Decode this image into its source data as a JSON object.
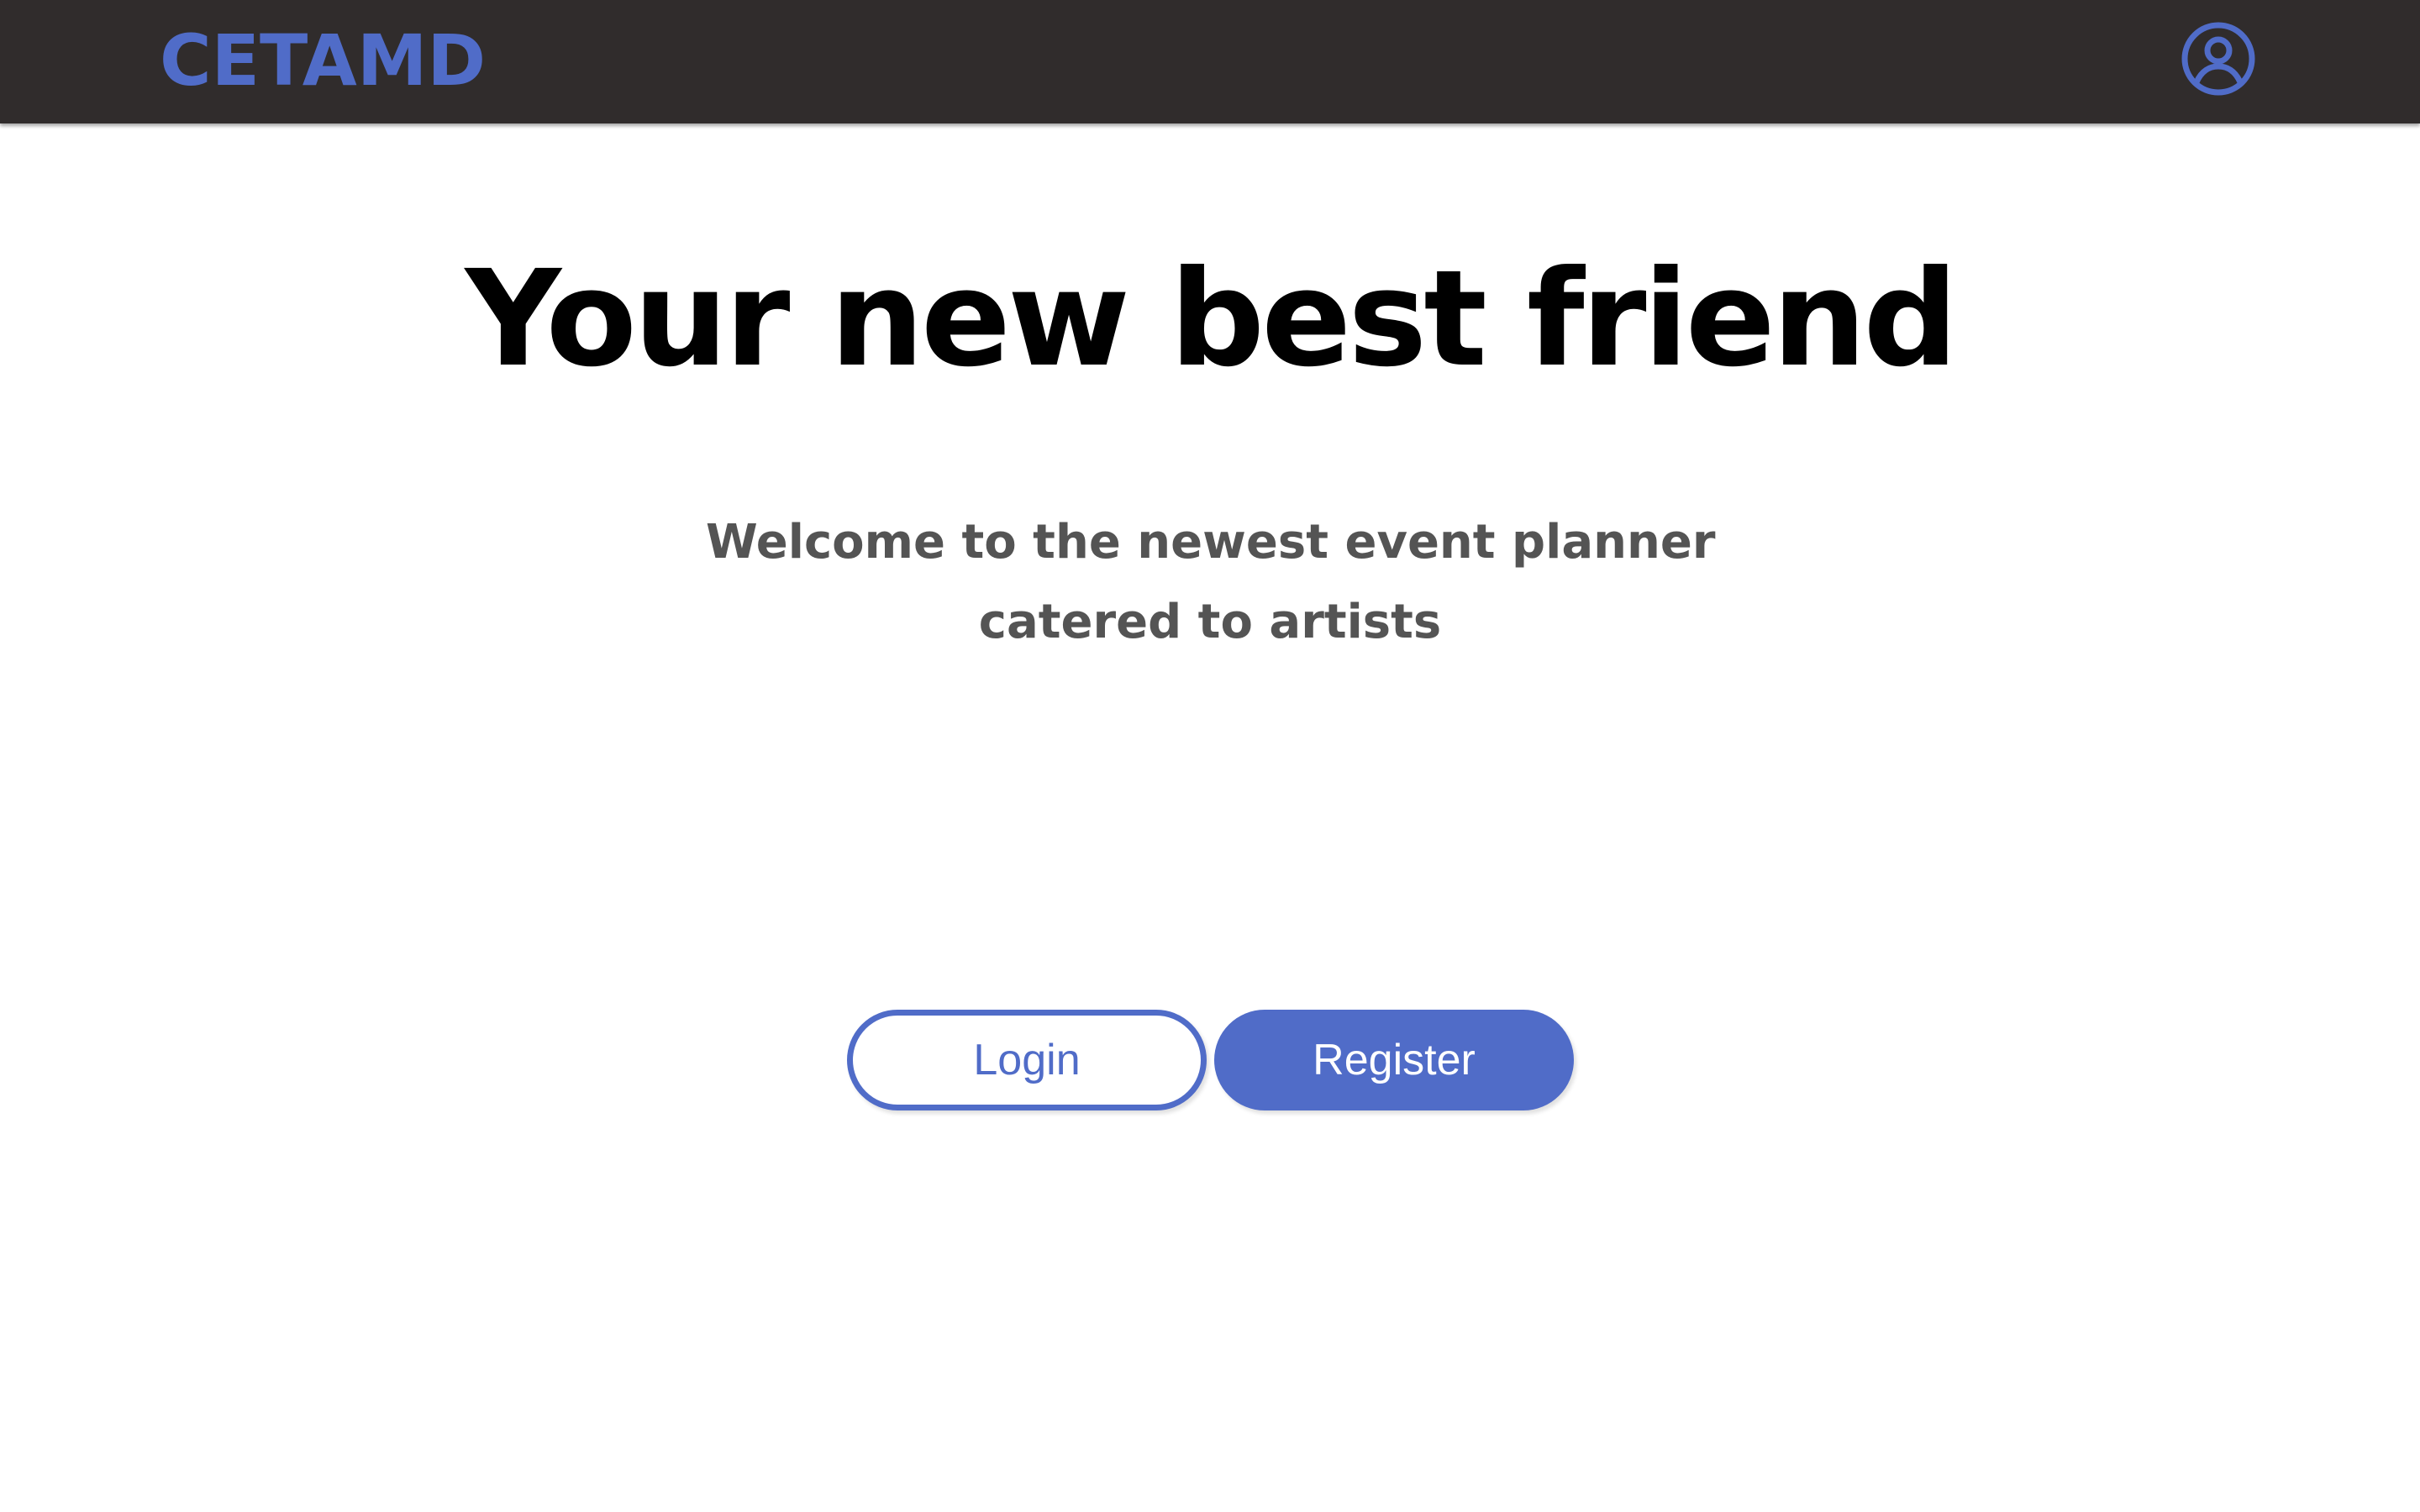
{
  "app": {
    "brand": "CETAMD"
  },
  "header": {
    "profile_icon": "user-circle-icon"
  },
  "hero": {
    "title": "Your new best friend",
    "subtitle_line1": "Welcome to the newest event planner",
    "subtitle_line2": "catered to artists"
  },
  "actions": {
    "login_label": "Login",
    "register_label": "Register"
  },
  "colors": {
    "accent": "#506cc8",
    "navbar": "#302c2c",
    "subtitle": "#545454"
  }
}
